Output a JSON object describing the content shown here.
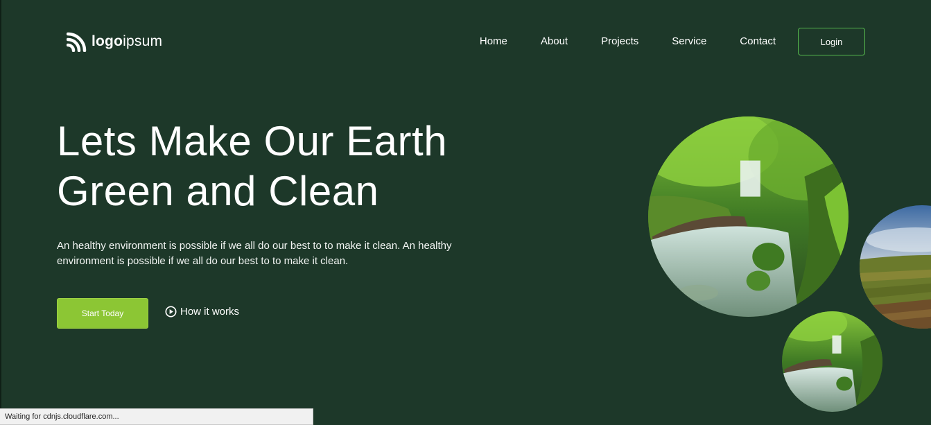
{
  "logo": {
    "bold": "logo",
    "light": "ipsum",
    "icon": "logo-arcs-icon"
  },
  "nav": {
    "items": [
      "Home",
      "About",
      "Projects",
      "Service",
      "Contact"
    ],
    "login": "Login"
  },
  "hero": {
    "title_line1": "Lets Make Our Earth",
    "title_line2": "Green and Clean",
    "description": "An healthy environment is possible if we all do our best to to make it clean. An healthy environment is possible if we all do our best to to make it clean.",
    "primary_cta": "Start Today",
    "secondary_cta": "How it works"
  },
  "images": [
    "waterfall-forest-image",
    "vineyard-landscape-image",
    "waterfall-forest-image-small"
  ],
  "status_bar": "Waiting for cdnjs.cloudflare.com...",
  "colors": {
    "background": "#1d3829",
    "accent_green": "#8cc634",
    "login_border": "#56b94d"
  }
}
